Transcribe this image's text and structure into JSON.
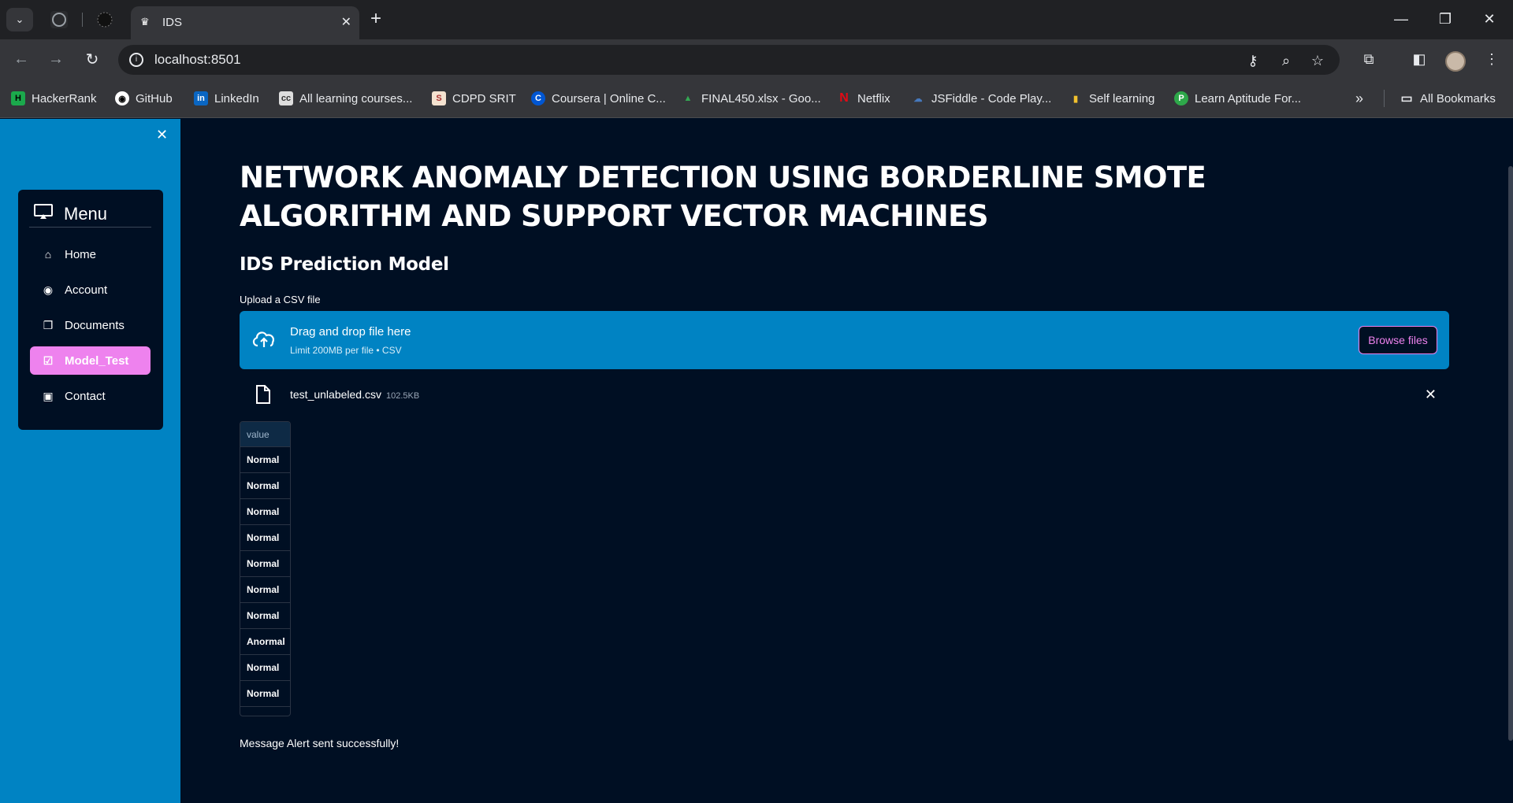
{
  "browser": {
    "tab_title": "IDS",
    "url": "localhost:8501",
    "bookmarks": [
      "HackerRank",
      "GitHub",
      "LinkedIn",
      "All learning courses...",
      "CDPD SRIT",
      "Coursera | Online C...",
      "FINAL450.xlsx - Goo...",
      "Netflix",
      "JSFiddle - Code Play...",
      "Self learning",
      "Learn Aptitude For..."
    ],
    "all_bookmarks": "All Bookmarks"
  },
  "sidebar": {
    "menu_title": "Menu",
    "items": [
      {
        "label": "Home",
        "icon": "house-icon"
      },
      {
        "label": "Account",
        "icon": "person-circle-icon"
      },
      {
        "label": "Documents",
        "icon": "documents-icon"
      },
      {
        "label": "Model_Test",
        "icon": "check-square-icon",
        "active": true
      },
      {
        "label": "Contact",
        "icon": "contact-card-icon"
      }
    ]
  },
  "main": {
    "title": "NETWORK ANOMALY DETECTION USING BORDERLINE SMOTE ALGORITHM AND SUPPORT VECTOR MACHINES",
    "subtitle": "IDS Prediction Model",
    "uploader": {
      "label": "Upload a CSV file",
      "drag_text": "Drag and drop file here",
      "limit_text": "Limit 200MB per file • CSV",
      "browse_label": "Browse files"
    },
    "file": {
      "name": "test_unlabeled.csv",
      "size": "102.5KB"
    },
    "table": {
      "header": "value",
      "rows": [
        "Normal",
        "Normal",
        "Normal",
        "Normal",
        "Normal",
        "Normal",
        "Normal",
        "Anormal",
        "Normal",
        "Normal"
      ]
    },
    "alert": "Message Alert sent successfully!"
  },
  "colors": {
    "background": "#000f23",
    "sidebar": "#0083c3",
    "accent": "#ee82ee"
  }
}
